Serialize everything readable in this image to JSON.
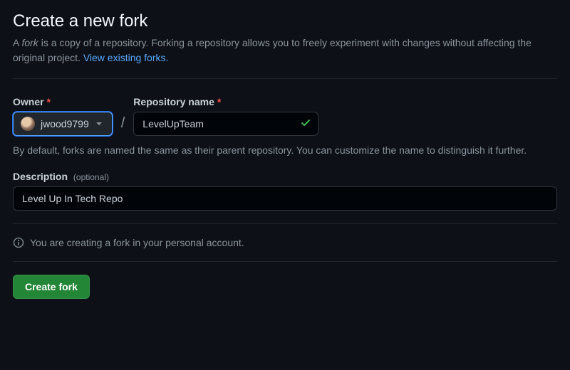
{
  "title": "Create a new fork",
  "lead": {
    "prefix": "A ",
    "fork_word": "fork",
    "body": " is a copy of a repository. Forking a repository allows you to freely experiment with changes without affecting the original project. ",
    "link_text": "View existing forks."
  },
  "owner": {
    "label": "Owner",
    "value": "jwood9799"
  },
  "repo": {
    "label": "Repository name",
    "value": "LevelUpTeam",
    "help": "By default, forks are named the same as their parent repository. You can customize the name to distinguish it further."
  },
  "description": {
    "label": "Description",
    "optional": "(optional)",
    "value": "Level Up In Tech Repo"
  },
  "notice": "You are creating a fork in your personal account.",
  "submit_label": "Create fork",
  "colors": {
    "accent_green": "#238636",
    "link_blue": "#58a6ff",
    "danger_red": "#f85149"
  }
}
